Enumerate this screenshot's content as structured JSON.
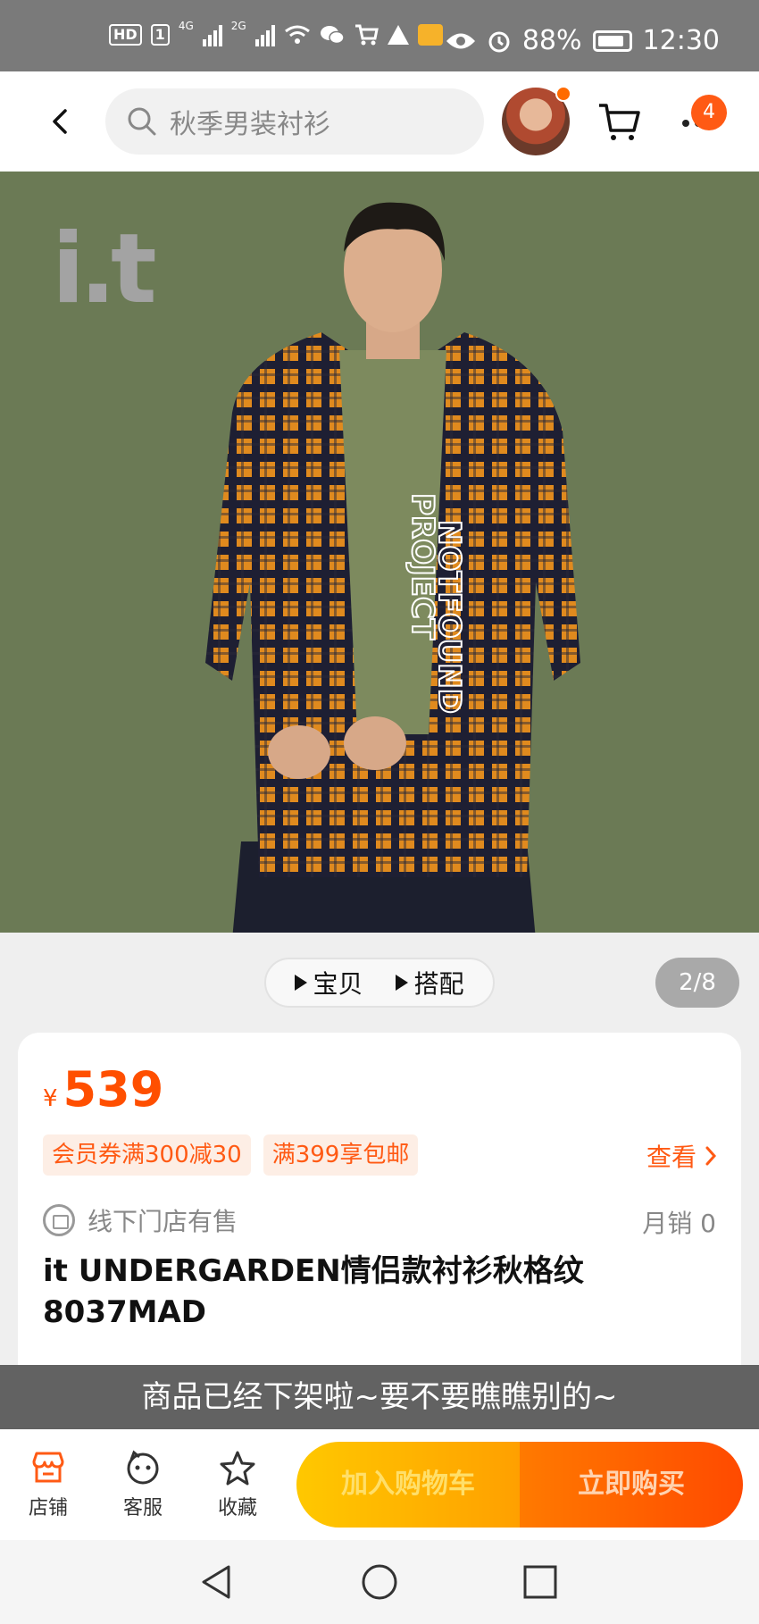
{
  "status_bar": {
    "hd_label": "HD",
    "hd_sim": "1",
    "net1": "4G",
    "net2": "2G",
    "battery": "88%",
    "time": "12:30"
  },
  "header": {
    "search_placeholder": "秋季男装衬衫",
    "more_badge": "4"
  },
  "product_image": {
    "brand_logo": "i.t",
    "shirt_print_line1": "NOTFOUND",
    "shirt_print_line2": "PROJECT"
  },
  "media_toggle": {
    "tab1": "宝贝",
    "tab2": "搭配"
  },
  "page_indicator": "2/8",
  "product": {
    "currency": "¥",
    "price": "539",
    "promo_tags": [
      "会员券满300减30",
      "满399享包邮"
    ],
    "view_label": "查看",
    "store_text": "线下门店有售",
    "monthly_sales": "月销 0",
    "title": "it UNDERGARDEN情侣款衬衫秋格纹8037MAD"
  },
  "toast": "商品已经下架啦~要不要瞧瞧别的~",
  "action_bar": {
    "shop": "店铺",
    "service": "客服",
    "favorite": "收藏",
    "add_to_cart": "加入购物车",
    "buy_now": "立即购买"
  },
  "colors": {
    "accent": "#ff5a14",
    "image_bg": "#6b7a55",
    "cart_button": "#ffb400",
    "buy_button": "#ff5a00"
  }
}
